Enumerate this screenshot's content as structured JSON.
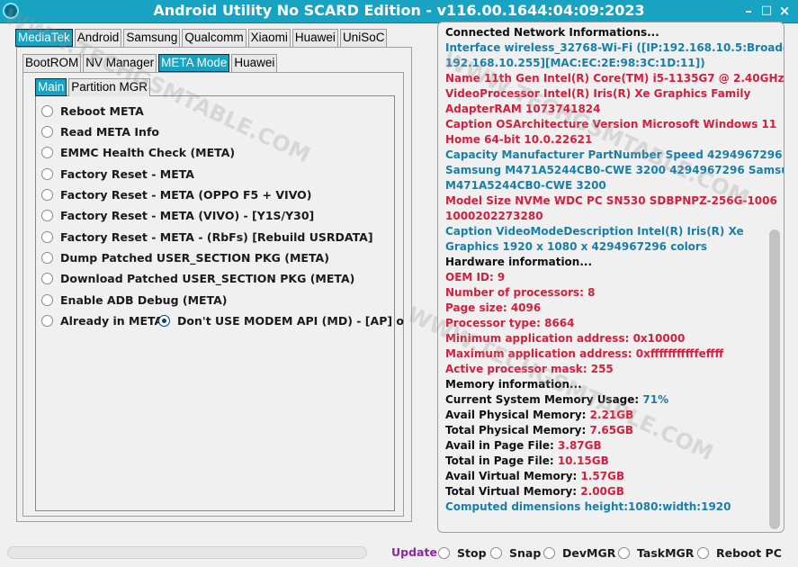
{
  "window": {
    "title": "Android Utility No SCARD Edition - v116.00.1644:04:09:2023",
    "minimize_glyph": "–",
    "maximize_glyph": "□",
    "close_glyph": "×",
    "app_icon": "app-logo-icon"
  },
  "tabs_brand": [
    {
      "label": "MediaTek",
      "active": true
    },
    {
      "label": "Android",
      "active": false
    },
    {
      "label": "Samsung",
      "active": false
    },
    {
      "label": "Qualcomm",
      "active": false
    },
    {
      "label": "Xiaomi",
      "active": false
    },
    {
      "label": "Huawei",
      "active": false
    },
    {
      "label": "UniSoC",
      "active": false
    }
  ],
  "tabs_mode": [
    {
      "label": "BootROM",
      "active": false
    },
    {
      "label": "NV Manager",
      "active": false
    },
    {
      "label": "META Mode",
      "active": true
    },
    {
      "label": "Huawei",
      "active": false
    }
  ],
  "tabs_sub": [
    {
      "label": "Main",
      "active": true
    },
    {
      "label": "Partition MGR",
      "active": false
    }
  ],
  "options": [
    {
      "label": "Reboot META",
      "checked": false
    },
    {
      "label": "Read META Info",
      "checked": false
    },
    {
      "label": "EMMC Health Check (META)",
      "checked": false
    },
    {
      "label": "Factory Reset - META",
      "checked": false
    },
    {
      "label": "Factory Reset - META (OPPO F5 + VIVO)",
      "checked": false
    },
    {
      "label": "Factory Reset - META (VIVO) - [Y1S/Y30]",
      "checked": false
    },
    {
      "label": "Factory Reset - META - (RbFs) [Rebuild USRDATA]",
      "checked": false
    },
    {
      "label": "Dump Patched USER_SECTION PKG (META)",
      "checked": false
    },
    {
      "label": "Download Patched USER_SECTION PKG (META)",
      "checked": false
    },
    {
      "label": "Enable ADB Debug (META)",
      "checked": false
    }
  ],
  "inline_options": [
    {
      "label": "Already in META",
      "checked": false
    },
    {
      "label": "Don't USE MODEM API (MD) - [AP] o",
      "checked": true
    }
  ],
  "log": {
    "lines": [
      {
        "text": "Connected Network Informations...",
        "color": "black"
      },
      {
        "text": "Interface wireless_32768-Wi-Fi ([IP:192.168.10.5:Broadcast:",
        "color": "blue"
      },
      {
        "text": "192.168.10.255][MAC:EC:2E:98:3C:1D:11])",
        "color": "blue"
      },
      {
        "text": "Name 11th Gen Intel(R) Core(TM) i5-1135G7 @ 2.40GHz",
        "color": "red"
      },
      {
        "text": "VideoProcessor Intel(R) Iris(R) Xe Graphics Family",
        "color": "red"
      },
      {
        "text": "AdapterRAM 1073741824",
        "color": "red"
      },
      {
        "text": "Caption OSArchitecture Version Microsoft Windows 11",
        "color": "red"
      },
      {
        "text": "Home 64-bit 10.0.22621",
        "color": "red"
      },
      {
        "text": "Capacity Manufacturer PartNumber Speed 4294967296",
        "color": "blue"
      },
      {
        "text": "Samsung M471A5244CB0-CWE 3200 4294967296 Samsung",
        "color": "blue"
      },
      {
        "text": "M471A5244CB0-CWE 3200",
        "color": "blue"
      },
      {
        "text": "Model Size NVMe WDC PC SN530 SDBPNPZ-256G-1006",
        "color": "red"
      },
      {
        "text": "1000202273280",
        "color": "red"
      },
      {
        "text": "Caption VideoModeDescription Intel(R) Iris(R) Xe",
        "color": "blue"
      },
      {
        "text": "Graphics 1920 x 1080 x 4294967296 colors",
        "color": "blue"
      },
      {
        "text": "Hardware information...",
        "color": "black"
      },
      {
        "text": "OEM ID: 9",
        "color": "red"
      },
      {
        "text": "Number of processors: 8",
        "color": "red"
      },
      {
        "text": "Page size: 4096",
        "color": "red"
      },
      {
        "text": "Processor type: 8664",
        "color": "red"
      },
      {
        "text": "Minimum application address: 0x10000",
        "color": "red"
      },
      {
        "text": "Maximum application address: 0xfffffffffffeffff",
        "color": "red"
      },
      {
        "text": "Active processor mask: 255",
        "color": "red"
      },
      {
        "text": "Memory information...",
        "color": "black"
      }
    ],
    "pairs": [
      {
        "label": "Current System Memory Usage: ",
        "value": "71%"
      },
      {
        "label": "Avail Physical Memory: ",
        "value": "2.21GB"
      },
      {
        "label": "Total Physical Memory: ",
        "value": "7.65GB"
      },
      {
        "label": "Avail in Page File: ",
        "value": "3.87GB"
      },
      {
        "label": "Total in Page File: ",
        "value": "10.15GB"
      },
      {
        "label": "Avail Virtual Memory: ",
        "value": "1.57GB"
      },
      {
        "label": "Total Virtual Memory: ",
        "value": "2.00GB"
      }
    ],
    "last_line": "Computed dimensions height:1080:width:1920"
  },
  "progress": 0,
  "bottom": {
    "update_label": "Update",
    "options": [
      {
        "label": "Stop",
        "checked": false
      },
      {
        "label": "Snap",
        "checked": false
      },
      {
        "label": "DevMGR",
        "checked": false
      },
      {
        "label": "TaskMGR",
        "checked": false
      },
      {
        "label": "Reboot PC",
        "checked": false
      }
    ]
  },
  "watermark_text": "WWW.TECHGSMTABLE.COM",
  "colors": {
    "accent": "#17a3c1",
    "log_black": "#111111",
    "log_blue": "#1a7fa6",
    "log_red": "#d0213f",
    "update": "#8a2a9a"
  }
}
